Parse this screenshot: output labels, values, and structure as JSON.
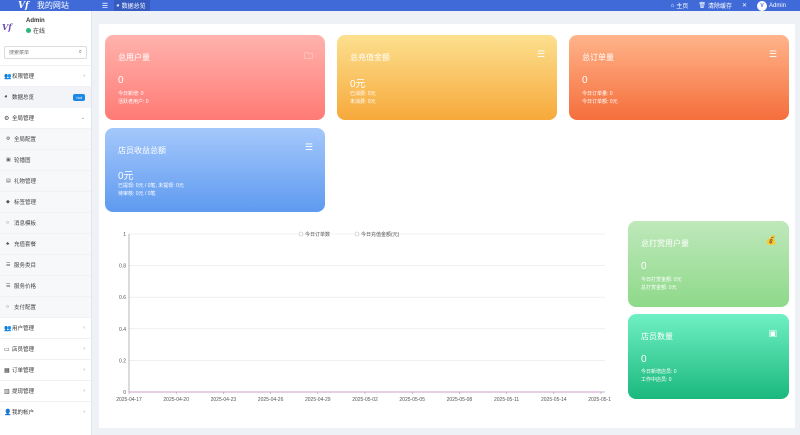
{
  "header": {
    "site_name": "我的网站",
    "tab": "数据总览",
    "home": "主页",
    "clear_cache": "清除缓存",
    "user": "Admin"
  },
  "sidebar": {
    "user_name": "Admin",
    "status": "在线",
    "search_placeholder": "搜索菜单",
    "items": [
      {
        "label": "权限管理",
        "icon": "users-icon"
      },
      {
        "label": "数据总览",
        "icon": "dashboard-icon",
        "badge": "hot"
      },
      {
        "label": "全局管理",
        "icon": "cogs-icon"
      }
    ],
    "sub_items": [
      {
        "label": "全局配置",
        "icon": "gear-icon"
      },
      {
        "label": "轮播图",
        "icon": "image-icon"
      },
      {
        "label": "礼物管理",
        "icon": "gift-icon"
      },
      {
        "label": "标签管理",
        "icon": "tag-icon"
      },
      {
        "label": "消息模板",
        "icon": "circle-icon"
      },
      {
        "label": "充值套餐",
        "icon": "group-icon"
      },
      {
        "label": "服务类目",
        "icon": "list-icon"
      },
      {
        "label": "服务价格",
        "icon": "list-icon"
      },
      {
        "label": "支付配置",
        "icon": "circle-icon"
      }
    ],
    "bottom_items": [
      {
        "label": "用户管理",
        "icon": "users-icon"
      },
      {
        "label": "店员管理",
        "icon": "card-icon"
      },
      {
        "label": "订单管理",
        "icon": "order-icon"
      },
      {
        "label": "提现管理",
        "icon": "withdraw-icon"
      },
      {
        "label": "我的帐户",
        "icon": "user-icon"
      }
    ]
  },
  "cards": {
    "users": {
      "title": "总用户量",
      "value": "0",
      "line1": "今日新增: 0",
      "line2": "活跃老用户: 0"
    },
    "recharge": {
      "title": "总充值金额",
      "value": "0元",
      "line1": "已消费: 0元",
      "line2": "未消费: 0元"
    },
    "orders": {
      "title": "总订单量",
      "value": "0",
      "line1": "今日订单量: 0",
      "line2": "今日订单额: 0元"
    },
    "income": {
      "title": "店员收益总额",
      "value": "0元",
      "line1": "已提现: 0元 / 0笔, 未提现: 0元",
      "line2": "待审核: 0元 / 0笔"
    },
    "tippers": {
      "title": "总打赏用户量",
      "value": "0",
      "line1": "今日打赏金额: 0元",
      "line2": "总打赏金额: 0元"
    },
    "staff": {
      "title": "店员数量",
      "value": "0",
      "line1": "今日新增店员: 0",
      "line2": "工作中店员: 0"
    }
  },
  "colors": {
    "header": "#3f6ad8",
    "users_card": [
      "#ffb3ad",
      "#ff7a75"
    ],
    "recharge_card": [
      "#fce08f",
      "#f7a93b"
    ],
    "orders_card": [
      "#ffb48a",
      "#f56e3c"
    ],
    "income_card": [
      "#a5c8fb",
      "#5e9af0"
    ],
    "tippers_card": [
      "#bfe8bb",
      "#8ed98a"
    ],
    "staff_card": [
      "#6ff0c4",
      "#1bb87e"
    ]
  },
  "chart_data": {
    "type": "line",
    "categories": [
      "2025-04-17",
      "2025-04-20",
      "2025-04-23",
      "2025-04-26",
      "2025-04-29",
      "2025-05-02",
      "2025-05-05",
      "2025-05-08",
      "2025-05-11",
      "2025-05-14",
      "2025-05-17"
    ],
    "series": [
      {
        "name": "今日订单数",
        "values": [
          0,
          0,
          0,
          0,
          0,
          0,
          0,
          0,
          0,
          0,
          0
        ]
      },
      {
        "name": "今日充值金额(元)",
        "values": [
          0,
          0,
          0,
          0,
          0,
          0,
          0,
          0,
          0,
          0,
          0
        ]
      }
    ],
    "yticks": [
      "0",
      "0.2",
      "0.4",
      "0.6",
      "0.8",
      "1"
    ],
    "ylim": [
      0,
      1
    ],
    "grid": true,
    "legend": "top"
  }
}
